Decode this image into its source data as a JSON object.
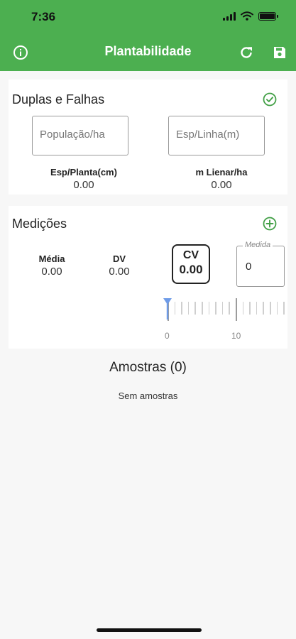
{
  "status_bar": {
    "time": "7:36"
  },
  "app_bar": {
    "title": "Plantabilidade",
    "icons": {
      "left": "info-icon",
      "refresh": "refresh-icon",
      "save": "save-icon"
    }
  },
  "duplas_falhas": {
    "title": "Duplas e Falhas",
    "action_icon": "check-circle-icon",
    "fields": [
      {
        "placeholder": "População/ha",
        "value": ""
      },
      {
        "placeholder": "Esp/Linha(m)",
        "value": ""
      }
    ],
    "stats": [
      {
        "label": "Esp/Planta(cm)",
        "value": "0.00"
      },
      {
        "label": "m Lienar/ha",
        "value": "0.00"
      }
    ]
  },
  "medicoes": {
    "title": "Medições",
    "action_icon": "add-circle-icon",
    "stats": [
      {
        "label": "Média",
        "value": "0.00"
      },
      {
        "label": "DV",
        "value": "0.00"
      }
    ],
    "cv": {
      "label": "CV",
      "value": "0.00"
    },
    "medida": {
      "legend": "Medida",
      "value": "0"
    },
    "ruler": {
      "labels": [
        "0",
        "10"
      ],
      "value": 0
    }
  },
  "amostras": {
    "title": "Amostras (0)",
    "empty_text": "Sem amostras"
  },
  "colors": {
    "primary": "#4caf50",
    "accent_icon": "#43a047",
    "pointer": "#6e9be8"
  }
}
